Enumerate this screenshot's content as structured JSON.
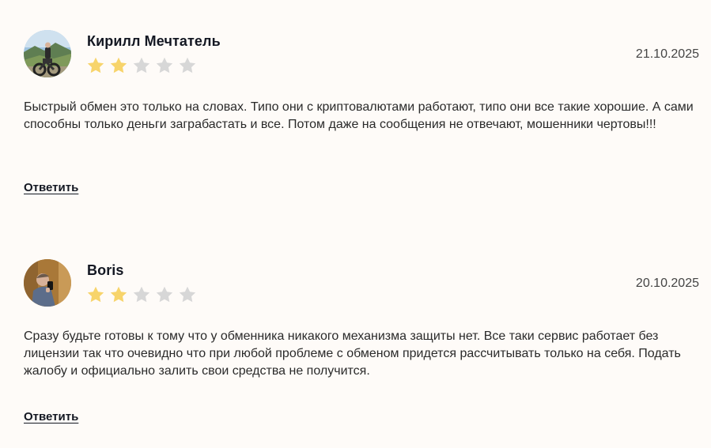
{
  "colors": {
    "background": "#fefbf8",
    "star_filled": "#f7d46b",
    "star_empty": "#d7d7d7"
  },
  "reviews": [
    {
      "author": "Кирилл Мечтатель",
      "date": "21.10.2025",
      "rating": 2,
      "max_rating": 5,
      "avatar_icon": "user-photo-motorcycle",
      "text": "Быстрый обмен это только на словах. Типо они с криптовалютами работают, типо они все такие хорошие. А сами способны только деньги заграбастать и все. Потом даже на сообщения не отвечают, мошенники чертовы!!!",
      "reply_label": "Ответить"
    },
    {
      "author": "Boris",
      "date": "20.10.2025",
      "rating": 2,
      "max_rating": 5,
      "avatar_icon": "user-photo-mirror-selfie",
      "text": "Сразу будьте готовы к тому что у обменника никакого механизма защиты нет. Все таки сервис работает без лицензии так что очевидно что при любой проблеме с обменом придется рассчитывать только на себя. Подать жалобу и официально залить свои средства не получится.",
      "reply_label": "Ответить"
    }
  ]
}
